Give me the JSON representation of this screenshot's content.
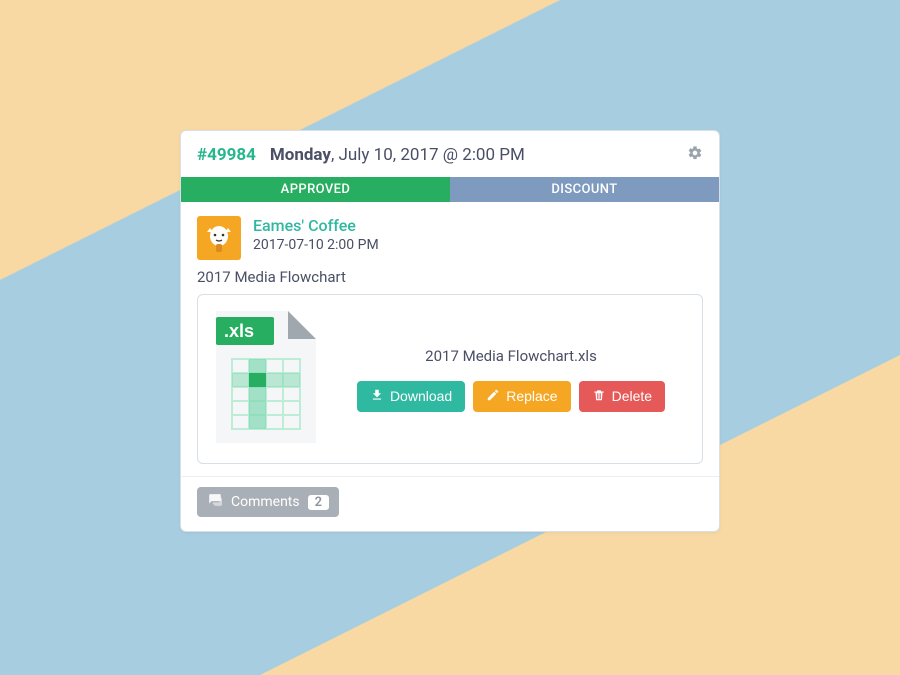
{
  "order": {
    "id": "#49984",
    "day": "Monday",
    "date_rest": ", July 10, 2017 @ 2:00 PM"
  },
  "status": {
    "approved": "APPROVED",
    "discount": "DISCOUNT"
  },
  "author": {
    "name": "Eames' Coffee",
    "timestamp": "2017-07-10 2:00 PM"
  },
  "attachment": {
    "title": "2017 Media Flowchart",
    "filename": "2017 Media Flowchart.xls",
    "ext_label": ".xls"
  },
  "buttons": {
    "download": "Download",
    "replace": "Replace",
    "delete": "Delete"
  },
  "comments": {
    "label": "Comments",
    "count": "2"
  },
  "colors": {
    "bg_blue": "#a7cde0",
    "bg_tan": "#f8d8a3",
    "accent": "#28b78c",
    "status_green": "#27ae60",
    "status_blue": "#7e9bbf",
    "btn_orange": "#f5a623",
    "btn_red": "#e55958",
    "text": "#4a4f66"
  }
}
